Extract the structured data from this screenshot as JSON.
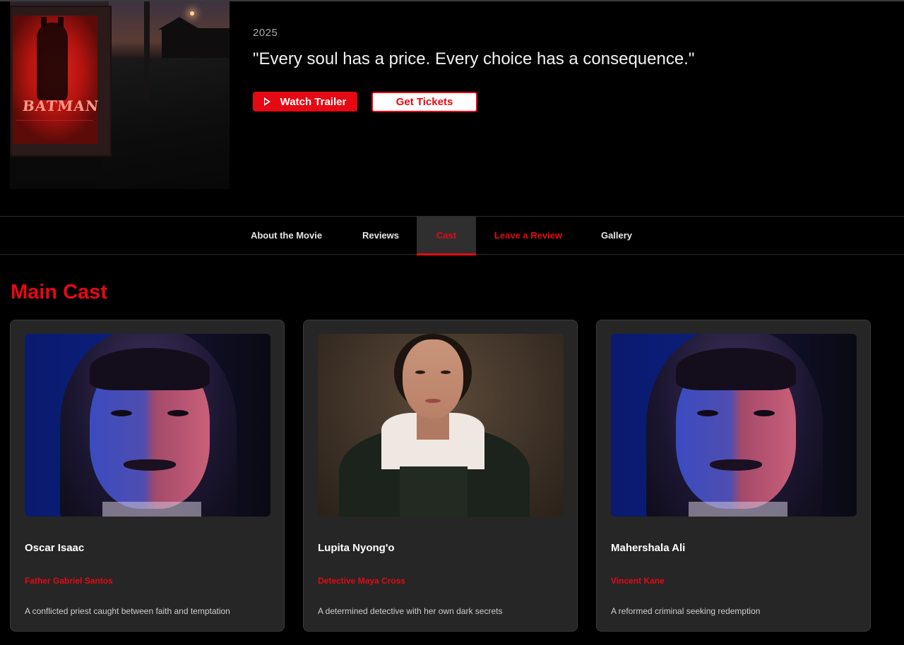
{
  "hero": {
    "year": "2025",
    "tagline": "\"Every soul has a price. Every choice has a consequence.\"",
    "poster_title": "BATMAN",
    "watch_trailer_label": "Watch Trailer",
    "get_tickets_label": "Get Tickets"
  },
  "tabs": [
    {
      "label": "About the Movie"
    },
    {
      "label": "Reviews"
    },
    {
      "label": "Cast"
    },
    {
      "label": "Leave a Review"
    },
    {
      "label": "Gallery"
    }
  ],
  "active_tab": "Cast",
  "section": {
    "title": "Main Cast"
  },
  "cast": [
    {
      "name": "Oscar Isaac",
      "role": "Father Gabriel Santos",
      "description": "A conflicted priest caught between faith and temptation"
    },
    {
      "name": "Lupita Nyong'o",
      "role": "Detective Maya Cross",
      "description": "A determined detective with her own dark secrets"
    },
    {
      "name": "Mahershala Ali",
      "role": "Vincent Kane",
      "description": "A reformed criminal seeking redemption"
    }
  ],
  "colors": {
    "accent": "#e50914",
    "background": "#000000",
    "card": "#262626"
  }
}
